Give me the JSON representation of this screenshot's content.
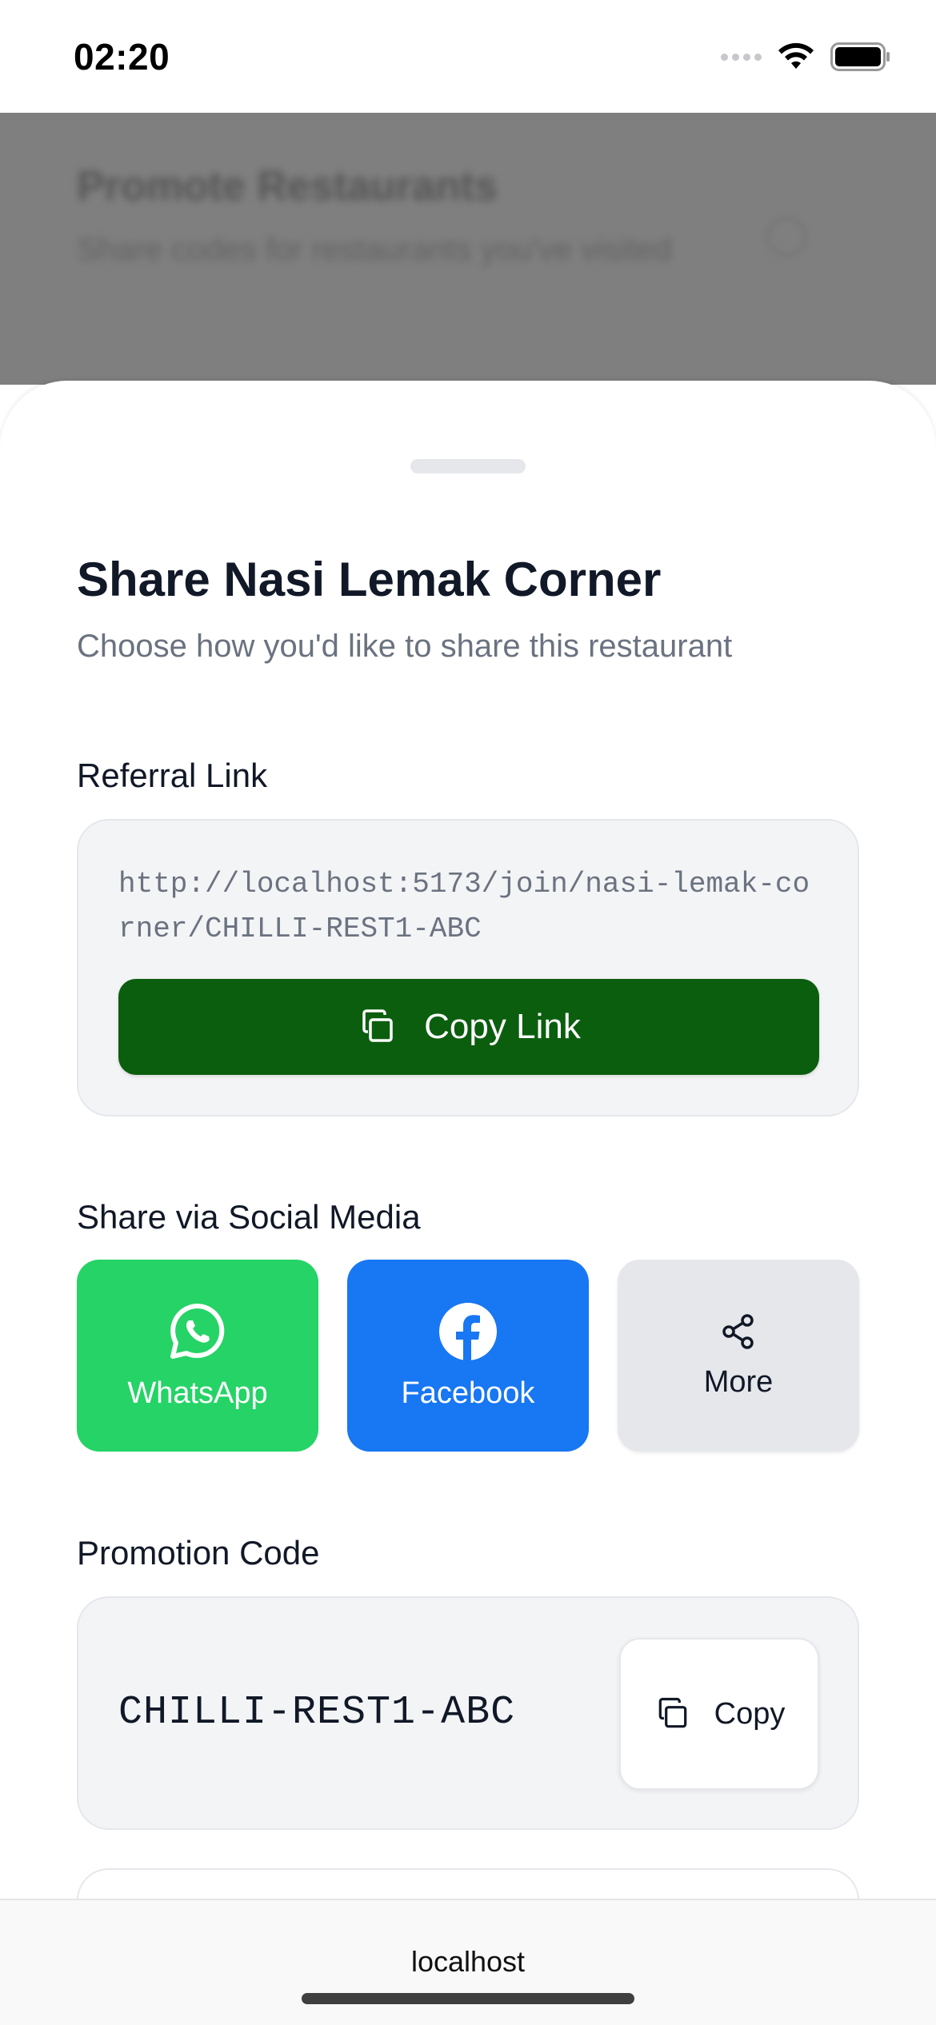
{
  "status_bar": {
    "time": "02:20",
    "icons": [
      "cellular-signal-icon",
      "wifi-icon",
      "battery-icon"
    ]
  },
  "background_page": {
    "title": "Promote Restaurants",
    "subtitle": "Share codes for restaurants you've visited"
  },
  "sheet": {
    "title": "Share Nasi Lemak Corner",
    "subtitle": "Choose how you'd like to share this restaurant",
    "referral": {
      "label": "Referral Link",
      "url": "http://localhost:5173/join/nasi-lemak-corner/CHILLI-REST1-ABC",
      "copy_button_label": "Copy Link",
      "copy_icon": "copy-icon"
    },
    "social": {
      "label": "Share via Social Media",
      "buttons": [
        {
          "label": "WhatsApp",
          "icon": "whatsapp-icon",
          "color": "#25D366"
        },
        {
          "label": "Facebook",
          "icon": "facebook-icon",
          "color": "#1877F2"
        },
        {
          "label": "More",
          "icon": "share-icon",
          "color": "#E5E7EB"
        }
      ]
    },
    "promotion": {
      "label": "Promotion Code",
      "code": "CHILLI-REST1-ABC",
      "copy_button_label": "Copy",
      "copy_icon": "copy-icon"
    }
  },
  "browser": {
    "url": "localhost"
  },
  "colors": {
    "primary_green": "#0B5E0E",
    "whatsapp": "#25D366",
    "facebook": "#1877F2",
    "card_bg": "#F3F4F6",
    "muted_text": "#6B7280"
  }
}
